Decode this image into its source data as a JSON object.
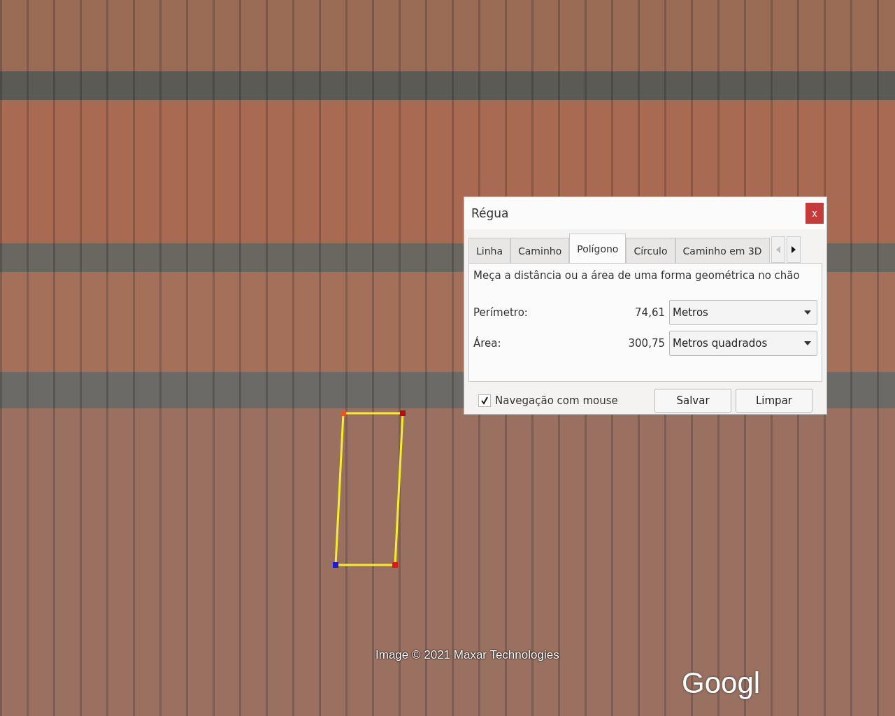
{
  "dialog": {
    "title": "Régua",
    "close": "x"
  },
  "tabs": [
    {
      "label": "Linha",
      "selected": false
    },
    {
      "label": "Caminho",
      "selected": false
    },
    {
      "label": "Polígono",
      "selected": true
    },
    {
      "label": "Círculo",
      "selected": false
    },
    {
      "label": "Caminho em 3D",
      "selected": false
    }
  ],
  "tab_scroll": {
    "left_disabled": true,
    "right_disabled": false
  },
  "description": "Meça a distância ou a área de uma forma geométrica no chão",
  "measurements": [
    {
      "label": "Perímetro:",
      "value": "74,61",
      "unit": "Metros"
    },
    {
      "label": "Área:",
      "value": "300,75",
      "unit": "Metros quadrados"
    }
  ],
  "mouse_navigation": {
    "label": "Navegação com mouse",
    "checked": true
  },
  "buttons": [
    "Salvar",
    "Limpar"
  ],
  "map": {
    "attribution": "Image © 2021 Maxar Technologies",
    "logo": "Googl"
  }
}
